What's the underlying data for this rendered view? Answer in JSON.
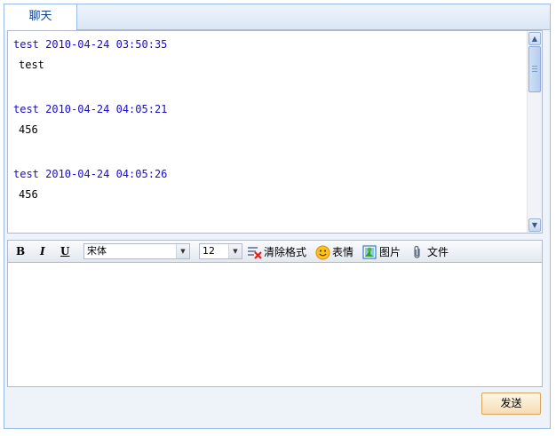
{
  "tab": {
    "label": "聊天"
  },
  "messages": [
    {
      "header": "test 2010-04-24 03:50:35",
      "body": "test"
    },
    {
      "header": "test 2010-04-24 04:05:21",
      "body": "456"
    },
    {
      "header": "test 2010-04-24 04:05:26",
      "body": "456"
    }
  ],
  "toolbar": {
    "bold": "B",
    "italic": "I",
    "underline": "U",
    "font_family": "宋体",
    "font_size": "12",
    "clear_format": "清除格式",
    "emoticon": "表情",
    "image": "图片",
    "file": "文件"
  },
  "send_label": "发送",
  "colors": {
    "border": "#99bbe8",
    "message_header": "#1a0dcc",
    "send_button": "#f4ddb3"
  }
}
